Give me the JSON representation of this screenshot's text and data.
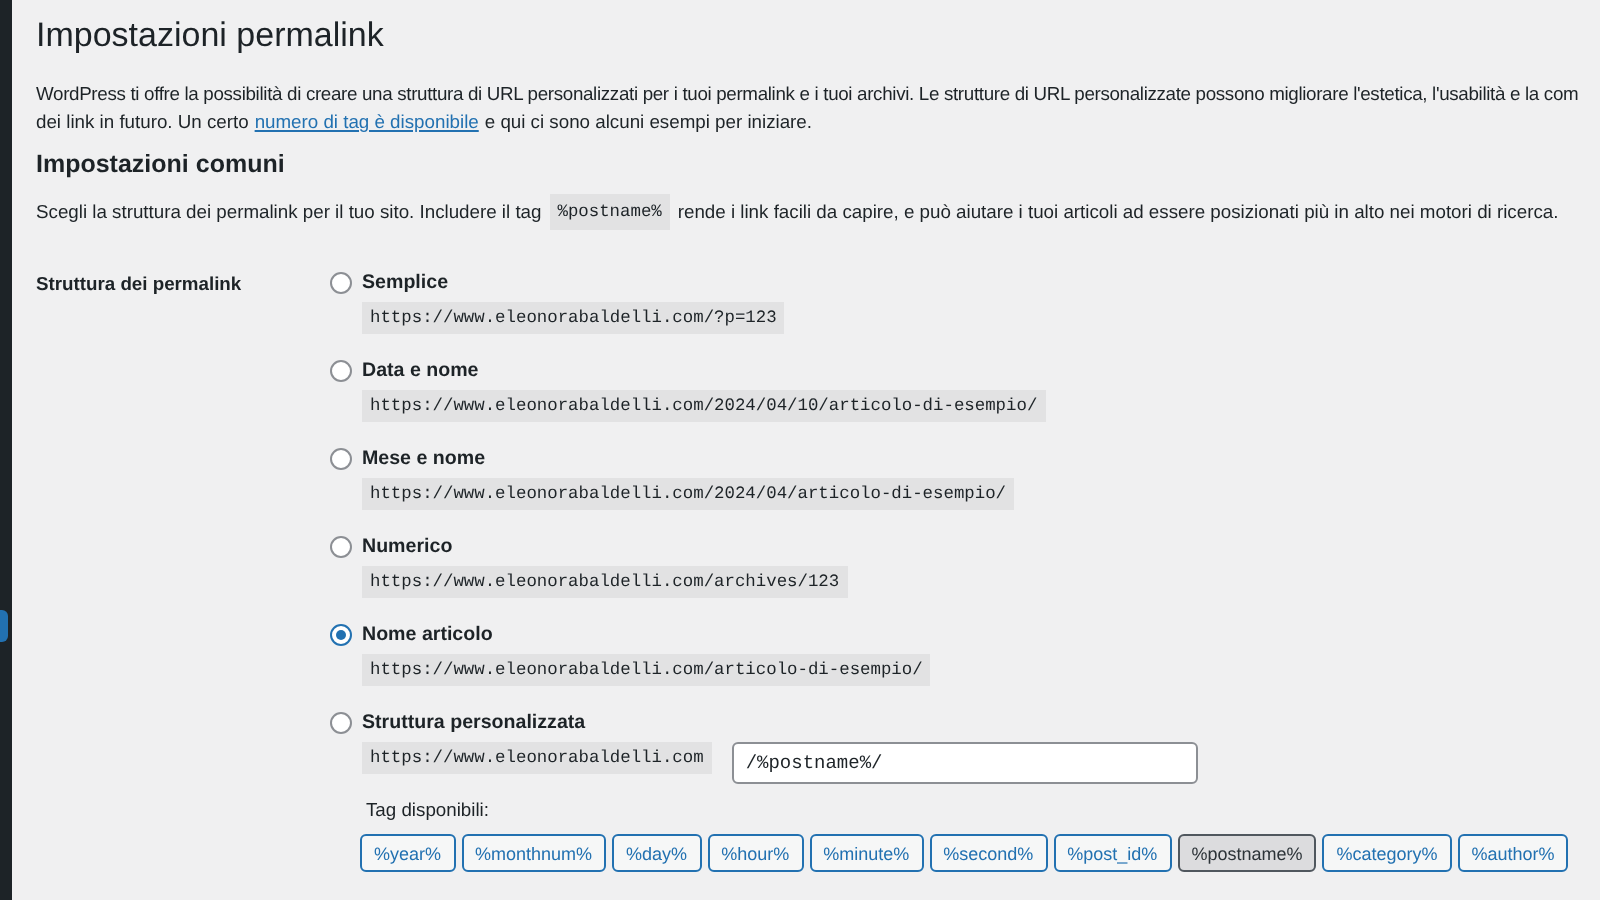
{
  "page": {
    "title": "Impostazioni permalink"
  },
  "intro": {
    "line_1": "WordPress ti offre la possibilità di creare una struttura di URL personalizzati per i tuoi permalink e i tuoi archivi. Le strutture di URL personalizzate possono migliorare l'estetica, l'usabilità e la com",
    "before": "dei link in futuro. Un certo",
    "link": "numero di tag è disponibile",
    "after": "e qui ci sono alcuni esempi per iniziare."
  },
  "section": {
    "title": "Impostazioni comuni",
    "before": "Scegli la struttura dei permalink per il tuo sito. Includere il tag",
    "code": "%postname%",
    "after": "rende i link facili da capire, e può aiutare i tuoi articoli ad essere posizionati più in alto nei motori di ricerca."
  },
  "field_label": "Struttura dei permalink",
  "options": [
    {
      "kind": "preset",
      "label": "Semplice",
      "example": "https://www.eleonorabaldelli.com/?p=123",
      "selected": false
    },
    {
      "kind": "preset",
      "label": "Data e nome",
      "example": "https://www.eleonorabaldelli.com/2024/04/10/articolo-di-esempio/",
      "selected": false
    },
    {
      "kind": "preset",
      "label": "Mese e nome",
      "example": "https://www.eleonorabaldelli.com/2024/04/articolo-di-esempio/",
      "selected": false
    },
    {
      "kind": "preset",
      "label": "Numerico",
      "example": "https://www.eleonorabaldelli.com/archives/123",
      "selected": false
    },
    {
      "kind": "preset",
      "label": "Nome articolo",
      "example": "https://www.eleonorabaldelli.com/articolo-di-esempio/",
      "selected": true
    },
    {
      "kind": "custom",
      "label": "Struttura personalizzata",
      "prefix": "https://www.eleonorabaldelli.com",
      "value": "/%postname%/",
      "selected": false
    }
  ],
  "tags_label": "Tag disponibili:",
  "tags": [
    {
      "label": "%year%",
      "selected": false
    },
    {
      "label": "%monthnum%",
      "selected": false
    },
    {
      "label": "%day%",
      "selected": false
    },
    {
      "label": "%hour%",
      "selected": false
    },
    {
      "label": "%minute%",
      "selected": false
    },
    {
      "label": "%second%",
      "selected": false
    },
    {
      "label": "%post_id%",
      "selected": false
    },
    {
      "label": "%postname%",
      "selected": true
    },
    {
      "label": "%category%",
      "selected": false
    },
    {
      "label": "%author%",
      "selected": false
    }
  ]
}
